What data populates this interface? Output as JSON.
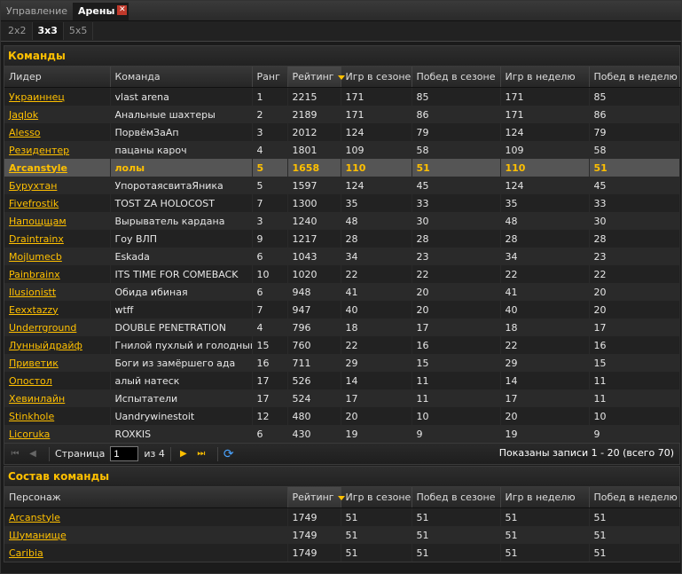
{
  "tabs_main": [
    {
      "label": "Управление",
      "active": false
    },
    {
      "label": "Арены",
      "active": true
    }
  ],
  "tabs_mode": [
    {
      "label": "2x2",
      "active": false
    },
    {
      "label": "3x3",
      "active": true
    },
    {
      "label": "5x5",
      "active": false
    }
  ],
  "teams": {
    "title": "Команды",
    "columns": [
      "Лидер",
      "Команда",
      "Ранг",
      "Рейтинг",
      "Игр в сезоне",
      "Побед в сезоне",
      "Игр в неделю",
      "Побед в неделю"
    ],
    "sorted_column": "Рейтинг",
    "rows": [
      [
        "Украиннец",
        "vlast arena",
        "1",
        "2215",
        "171",
        "85",
        "171",
        "85"
      ],
      [
        "Jaqlok",
        "Анальные шахтеры",
        "2",
        "2189",
        "171",
        "86",
        "171",
        "86"
      ],
      [
        "Alesso",
        "ПорвёмЗаАп",
        "3",
        "2012",
        "124",
        "79",
        "124",
        "79"
      ],
      [
        "Резидентер",
        "пацаны кароч",
        "4",
        "1801",
        "109",
        "58",
        "109",
        "58"
      ],
      [
        "Arcanstyle",
        "лолы",
        "5",
        "1658",
        "110",
        "51",
        "110",
        "51"
      ],
      [
        "Бурухтан",
        "УпоротаясвитаЯника",
        "5",
        "1597",
        "124",
        "45",
        "124",
        "45"
      ],
      [
        "Fivefrostik",
        "TOST ZA HOLOCOST",
        "7",
        "1300",
        "35",
        "33",
        "35",
        "33"
      ],
      [
        "Напощщам",
        "Вырыватель кардана",
        "3",
        "1240",
        "48",
        "30",
        "48",
        "30"
      ],
      [
        "Draintrainx",
        "Гоу ВЛП",
        "9",
        "1217",
        "28",
        "28",
        "28",
        "28"
      ],
      [
        "Mojlumecb",
        "Eskada",
        "6",
        "1043",
        "34",
        "23",
        "34",
        "23"
      ],
      [
        "Painbrainx",
        "ITS TIME FOR COMEBACK",
        "10",
        "1020",
        "22",
        "22",
        "22",
        "22"
      ],
      [
        "Ilusionistt",
        "Обида ибиная",
        "6",
        "948",
        "41",
        "20",
        "41",
        "20"
      ],
      [
        "Eexxtazzy",
        "wtff",
        "7",
        "947",
        "40",
        "20",
        "40",
        "20"
      ],
      [
        "Underrground",
        "DOUBLE PENETRATION",
        "4",
        "796",
        "18",
        "17",
        "18",
        "17"
      ],
      [
        "Лунныйдрайф",
        "Гнилой пухлый и голодный",
        "15",
        "760",
        "22",
        "16",
        "22",
        "16"
      ],
      [
        "Приветик",
        "Боги из замёршего ада",
        "16",
        "711",
        "29",
        "15",
        "29",
        "15"
      ],
      [
        "Опостол",
        "алый натеск",
        "17",
        "526",
        "14",
        "11",
        "14",
        "11"
      ],
      [
        "Хевинлайн",
        "Испытатели",
        "17",
        "524",
        "17",
        "11",
        "17",
        "11"
      ],
      [
        "Stinkhole",
        "Uandrywinestoit",
        "12",
        "480",
        "20",
        "10",
        "20",
        "10"
      ],
      [
        "Licoruka",
        "ROXKIS",
        "6",
        "430",
        "19",
        "9",
        "19",
        "9"
      ]
    ],
    "selected_row": 4
  },
  "pager": {
    "page_label": "Страница",
    "page_value": "1",
    "of_label": "из 4",
    "status": "Показаны записи 1 - 20 (всего 70)"
  },
  "roster": {
    "title": "Состав команды",
    "columns": [
      "Персонаж",
      "Рейтинг",
      "Игр в сезоне",
      "Побед в сезоне",
      "Игр в неделю",
      "Побед в неделю"
    ],
    "sorted_column": "Рейтинг",
    "rows": [
      [
        "Arcanstyle",
        "1749",
        "51",
        "51",
        "51",
        "51"
      ],
      [
        "Шуманище",
        "1749",
        "51",
        "51",
        "51",
        "51"
      ],
      [
        "Caribia",
        "1749",
        "51",
        "51",
        "51",
        "51"
      ]
    ]
  },
  "colors": {
    "accent": "#ffc000",
    "close": "#c0392b",
    "refresh": "#4aa3ff"
  }
}
